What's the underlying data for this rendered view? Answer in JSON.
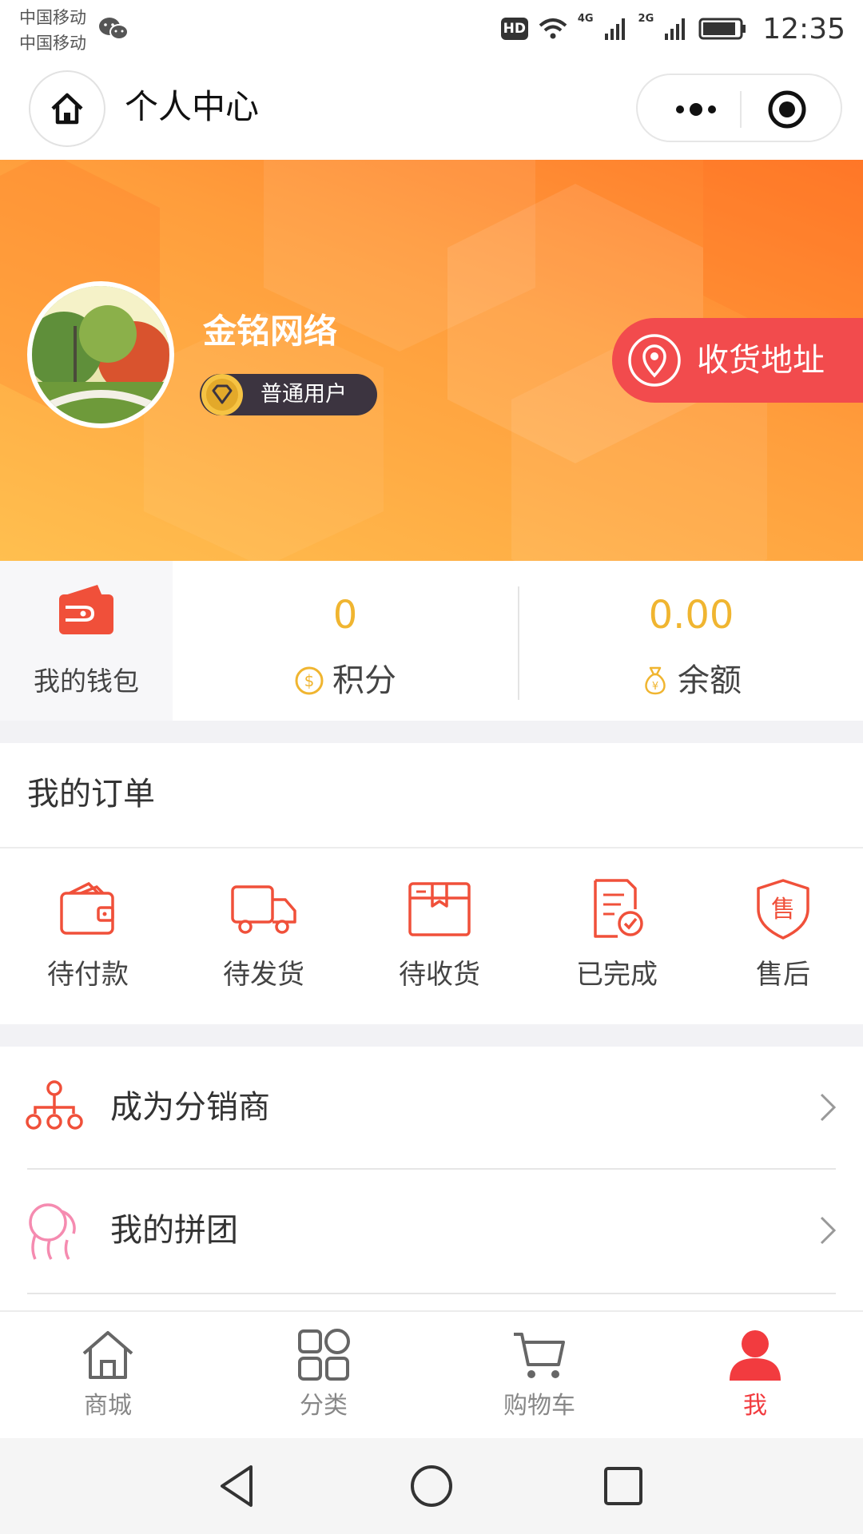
{
  "status_bar": {
    "carrier1": "中国移动",
    "carrier2": "中国移动",
    "hd": "HD",
    "net1": "4G",
    "net2": "2G",
    "time": "12:35"
  },
  "nav": {
    "title": "个人中心"
  },
  "profile": {
    "username": "金铭网络",
    "level": "普通用户",
    "address_button": "收货地址"
  },
  "stats": {
    "wallet_label": "我的钱包",
    "points_value": "0",
    "points_label": "积分",
    "balance_value": "0.00",
    "balance_label": "余额"
  },
  "orders": {
    "title": "我的订单",
    "items": [
      {
        "label": "待付款",
        "icon": "wallet-icon"
      },
      {
        "label": "待发货",
        "icon": "truck-icon"
      },
      {
        "label": "待收货",
        "icon": "box-icon"
      },
      {
        "label": "已完成",
        "icon": "completed-doc-icon"
      },
      {
        "label": "售后",
        "icon": "after-sale-shield-icon"
      }
    ]
  },
  "menu": {
    "items": [
      {
        "label": "成为分销商",
        "icon": "distribution-tree-icon"
      },
      {
        "label": "我的拼团",
        "icon": "group-buy-icon"
      }
    ]
  },
  "tabbar": {
    "items": [
      {
        "label": "商城",
        "icon": "home-icon"
      },
      {
        "label": "分类",
        "icon": "category-icon"
      },
      {
        "label": "购物车",
        "icon": "cart-icon"
      },
      {
        "label": "我",
        "icon": "user-icon",
        "active": true
      }
    ]
  },
  "colors": {
    "accent_red": "#f23b3f",
    "order_icon": "#f0503a",
    "stat_value": "#f0b530",
    "hero_gradient": [
      "#ff7a2a",
      "#ffbf4f"
    ]
  }
}
